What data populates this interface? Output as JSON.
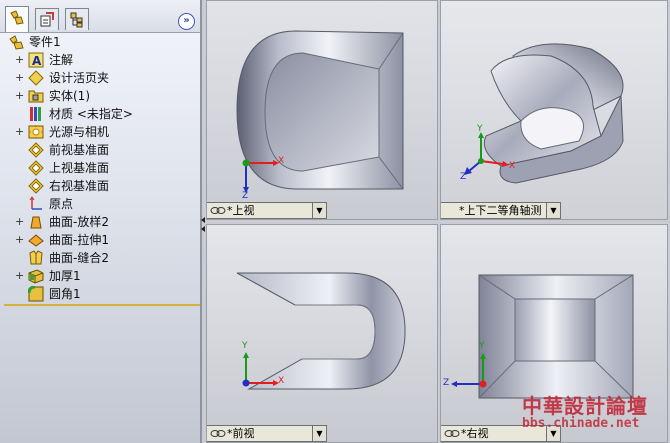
{
  "feature_tree": {
    "root": {
      "label": "零件1",
      "icon": "part-icon"
    },
    "items": [
      {
        "label": "注解",
        "icon": "annotation-icon",
        "expandable": true
      },
      {
        "label": "设计活页夹",
        "icon": "design-binder-icon",
        "expandable": true
      },
      {
        "label": "实体(1)",
        "icon": "solid-bodies-icon",
        "expandable": true
      },
      {
        "label": "材质 <未指定>",
        "icon": "material-icon",
        "expandable": false
      },
      {
        "label": "光源与相机",
        "icon": "lights-cameras-icon",
        "expandable": true
      },
      {
        "label": "前视基准面",
        "icon": "plane-icon",
        "expandable": false
      },
      {
        "label": "上视基准面",
        "icon": "plane-icon",
        "expandable": false
      },
      {
        "label": "右视基准面",
        "icon": "plane-icon",
        "expandable": false
      },
      {
        "label": "原点",
        "icon": "origin-icon",
        "expandable": false
      },
      {
        "label": "曲面-放样2",
        "icon": "surface-loft-icon",
        "expandable": true
      },
      {
        "label": "曲面-拉伸1",
        "icon": "surface-extrude-icon",
        "expandable": true
      },
      {
        "label": "曲面-缝合2",
        "icon": "surface-knit-icon",
        "expandable": false
      },
      {
        "label": "加厚1",
        "icon": "thicken-icon",
        "expandable": true
      },
      {
        "label": "圆角1",
        "icon": "fillet-icon",
        "expandable": false
      }
    ]
  },
  "panel": {
    "tabs": [
      "feature-manager-tab-icon",
      "property-manager-tab-icon",
      "configuration-manager-tab-icon"
    ],
    "expand_glyph": "»"
  },
  "viewports": {
    "top": {
      "label": "*上视"
    },
    "iso": {
      "label": "*上下二等角轴测"
    },
    "front": {
      "label": "*前视"
    },
    "right": {
      "label": "*右视"
    }
  },
  "axes": {
    "x": "X",
    "y": "Y",
    "z": "Z"
  },
  "watermark": {
    "title": "中華設計論壇",
    "url": "bbs.chinade.net"
  },
  "colors": {
    "axis_x": "#e02020",
    "axis_y": "#1a9a1a",
    "axis_z": "#2030c0",
    "watermark": "#c02a3a"
  }
}
